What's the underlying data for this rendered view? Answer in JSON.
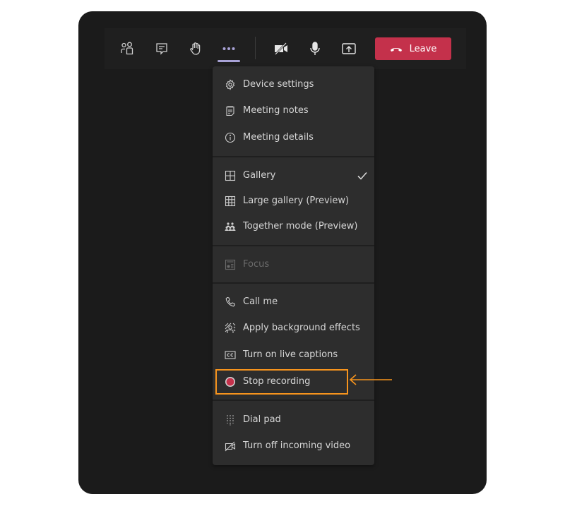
{
  "toolbar": {
    "buttons": [
      {
        "name": "participants-button",
        "icon": "people-icon"
      },
      {
        "name": "chat-button",
        "icon": "chat-icon"
      },
      {
        "name": "raise-hand-button",
        "icon": "hand-icon"
      },
      {
        "name": "more-actions-button",
        "icon": "more-icon",
        "active": true
      },
      {
        "name": "camera-button",
        "icon": "video-off-icon"
      },
      {
        "name": "mic-button",
        "icon": "mic-icon"
      },
      {
        "name": "share-button",
        "icon": "share-tray-icon"
      }
    ],
    "leave_label": "Leave",
    "leave_color": "#c4314b",
    "active_indicator_color": "#a8a2d6"
  },
  "menu": {
    "sections": [
      {
        "items": [
          {
            "label": "Device settings",
            "icon": "gear-icon"
          },
          {
            "label": "Meeting notes",
            "icon": "notes-icon"
          },
          {
            "label": "Meeting details",
            "icon": "info-icon"
          }
        ]
      },
      {
        "items": [
          {
            "label": "Gallery",
            "icon": "gallery-icon",
            "checked": true
          },
          {
            "label": "Large gallery (Preview)",
            "icon": "large-gallery-icon"
          },
          {
            "label": "Together mode (Preview)",
            "icon": "together-mode-icon"
          }
        ]
      },
      {
        "items": [
          {
            "label": "Focus",
            "icon": "focus-icon",
            "disabled": true
          }
        ]
      },
      {
        "items": [
          {
            "label": "Call me",
            "icon": "phone-icon"
          },
          {
            "label": "Apply background effects",
            "icon": "background-effects-icon"
          },
          {
            "label": "Turn on live captions",
            "icon": "captions-icon"
          },
          {
            "label": "Stop recording",
            "icon": "record-icon",
            "highlighted": true
          }
        ]
      },
      {
        "items": [
          {
            "label": "Dial pad",
            "icon": "dial-pad-icon"
          },
          {
            "label": "Turn off incoming video",
            "icon": "video-off-icon"
          }
        ]
      }
    ]
  },
  "annotation": {
    "highlight_color": "#f7941d",
    "target": "Stop recording"
  }
}
